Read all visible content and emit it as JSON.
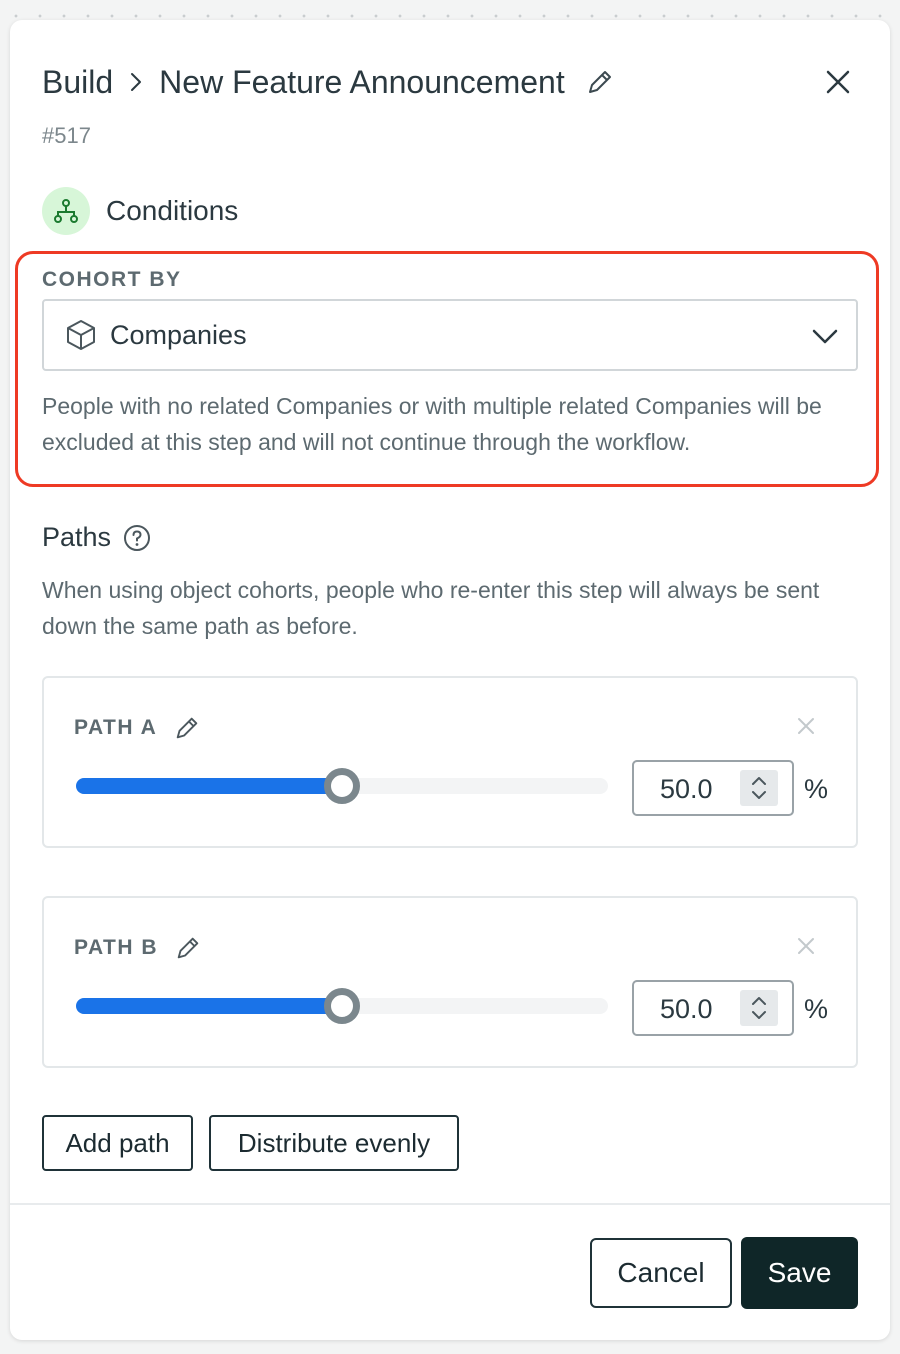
{
  "header": {
    "breadcrumb_root": "Build",
    "title": "New Feature Announcement",
    "ticket_id": "#517",
    "edit_icon": "pencil-icon",
    "close_icon": "close-icon"
  },
  "section": {
    "title": "Conditions",
    "icon": "branch-icon",
    "icon_bg": "#d7f6d8",
    "icon_color": "#1b7a2f"
  },
  "cohort": {
    "label": "COHORT BY",
    "selected": "Companies",
    "selected_icon": "cube-icon",
    "description": "People with no related Companies or with multiple related Companies will be excluded at this step and will not continue through the workflow.",
    "highlight_color": "#ee3a24"
  },
  "paths": {
    "title": "Paths",
    "help_icon": "help-circle-icon",
    "description": "When using object cohorts, people who re-enter this step will always be sent down the same path as before.",
    "items": [
      {
        "name": "PATH A",
        "value": "50.0",
        "percent": 50,
        "unit": "%"
      },
      {
        "name": "PATH B",
        "value": "50.0",
        "percent": 50,
        "unit": "%"
      }
    ],
    "slider_color": "#1a73e8"
  },
  "actions": {
    "add_path": "Add path",
    "distribute": "Distribute evenly"
  },
  "footer": {
    "cancel": "Cancel",
    "save": "Save",
    "save_bg": "#0f2628"
  }
}
